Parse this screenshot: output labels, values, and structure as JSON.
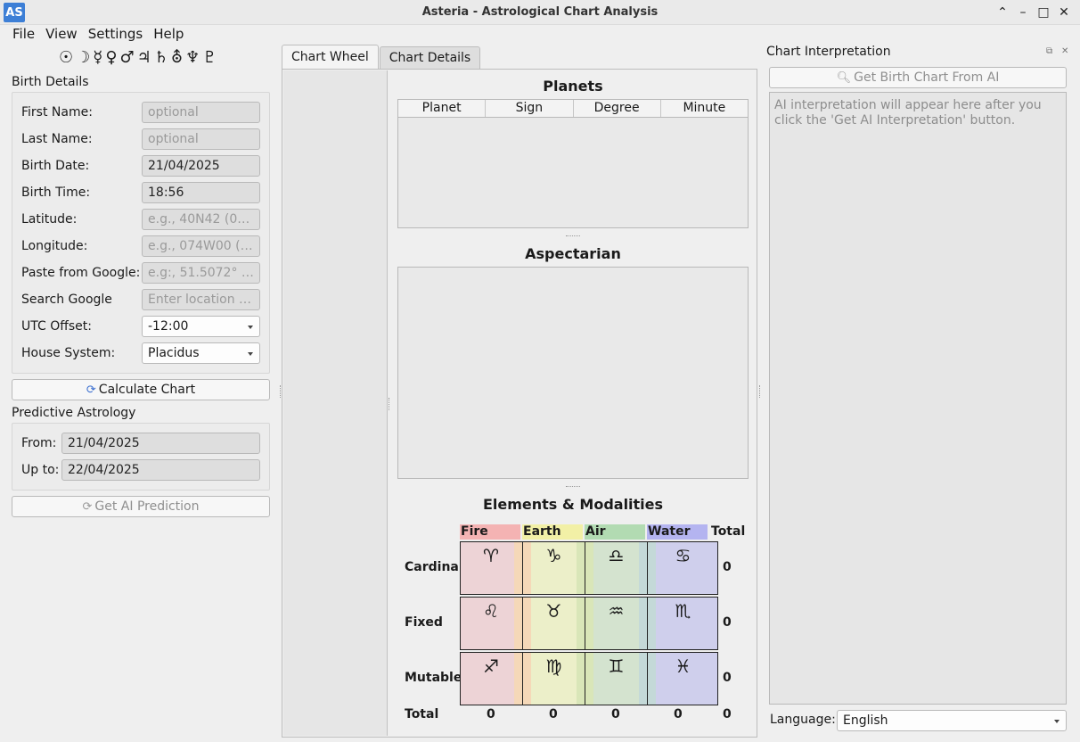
{
  "window": {
    "icon_text": "AS",
    "title": "Asteria - Astrological Chart Analysis",
    "controls": [
      "⌃",
      "–",
      "□",
      "✕"
    ]
  },
  "menu": [
    "File",
    "View",
    "Settings",
    "Help"
  ],
  "planet_glyphs": "☉☽☿♀♂♃♄⛢♆♇",
  "birth": {
    "title": "Birth Details",
    "first_name": {
      "label": "First Name:",
      "placeholder": "optional"
    },
    "last_name": {
      "label": "Last Name:",
      "placeholder": "optional"
    },
    "birth_date": {
      "label": "Birth Date:",
      "value": "21/04/2025"
    },
    "birth_time": {
      "label": "Birth Time:",
      "value": "18:56"
    },
    "latitude": {
      "label": "Latitude:",
      "placeholder": "e.g., 40N42 (0-9..."
    },
    "longitude": {
      "label": "Longitude:",
      "placeholder": "e.g., 074W00 (0-..."
    },
    "paste": {
      "label": "Paste from Google:",
      "placeholder": "e.g:, 51.5072° N..."
    },
    "search": {
      "label": "Search Google",
      "placeholder": "Enter location a..."
    },
    "utc": {
      "label": "UTC Offset:",
      "value": "-12:00"
    },
    "house": {
      "label": "House System:",
      "value": "Placidus"
    },
    "calc_button": "Calculate Chart"
  },
  "predictive": {
    "title": "Predictive Astrology",
    "from": {
      "label": "From:",
      "value": "21/04/2025"
    },
    "upto": {
      "label": "Up to:",
      "value": "22/04/2025"
    },
    "button": "Get AI Prediction"
  },
  "tabs": [
    "Chart Wheel",
    "Chart Details"
  ],
  "planets": {
    "title": "Planets",
    "columns": [
      "Planet",
      "Sign",
      "Degree",
      "Minute"
    ]
  },
  "aspectarian": {
    "title": "Aspectarian"
  },
  "elements": {
    "title": "Elements & Modalities",
    "columns": [
      "Fire",
      "Earth",
      "Air",
      "Water"
    ],
    "total_label": "Total",
    "colors": {
      "Fire": "#f4b3b3",
      "Earth": "#f2f0a6",
      "Air": "#b2dbb2",
      "Water": "#b4b4f0"
    },
    "cell_colors": {
      "Fire": "#edd3d6",
      "Earth": "#ecefc9",
      "Air": "#d4e3cf",
      "Water": "#cfcfec"
    },
    "strip_colors": {
      "Fire": "#f5d8b8",
      "Earth": "#d9e6b8",
      "Air": "#c4d9d8",
      "Water": "#c8c8ee"
    },
    "rows": [
      {
        "label": "Cardinal",
        "signs": [
          "♈",
          "♑",
          "♎",
          "♋"
        ],
        "total": "0"
      },
      {
        "label": "Fixed",
        "signs": [
          "♌",
          "♉",
          "♒",
          "♏"
        ],
        "total": "0"
      },
      {
        "label": "Mutable",
        "signs": [
          "♐",
          "♍",
          "♊",
          "♓"
        ],
        "total": "0"
      }
    ],
    "totals": [
      "0",
      "0",
      "0",
      "0",
      "0"
    ]
  },
  "interpretation": {
    "title": "Chart Interpretation",
    "button": "Get Birth Chart From AI",
    "placeholder": "AI interpretation will appear here after you click the 'Get AI Interpretation' button.",
    "language_label": "Language:",
    "language": "English"
  }
}
